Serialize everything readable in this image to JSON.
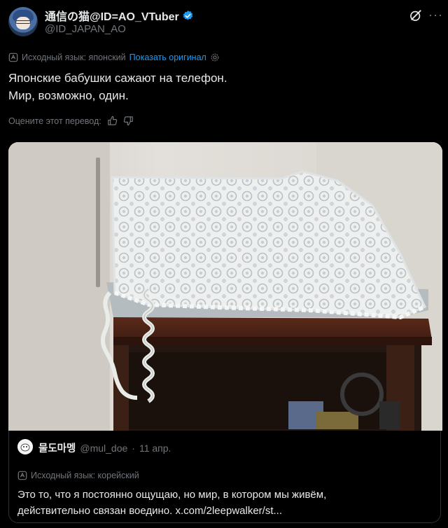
{
  "author": {
    "display_name": "通信の猫@ID=AO_VTuber",
    "handle": "@ID_JAPAN_AO"
  },
  "translation": {
    "source_lang": "Исходный язык: японский",
    "show_original": "Показать оригинал"
  },
  "tweet": {
    "line1": "Японские бабушки сажают на телефон.",
    "line2": "Мир, возможно, один."
  },
  "rating": {
    "prompt": "Оцените этот перевод:"
  },
  "media": {
    "icon": "photo-telephone-with-lace-cover"
  },
  "quote": {
    "display_name": "물도마멩",
    "handle": "@mul_doe",
    "separator": "·",
    "date": "11 апр.",
    "source_lang": "Исходный язык: корейский",
    "line1": "Это то, что я постоянно ощущаю, но мир, в котором мы живём,",
    "line2": "действительно связан воедино. x.com/2leepwalker/st..."
  },
  "colors": {
    "background": "#000000",
    "link": "#1d9bf0",
    "muted": "#71767b",
    "text": "#e7e9ea",
    "verified": "#1d9bf0"
  }
}
